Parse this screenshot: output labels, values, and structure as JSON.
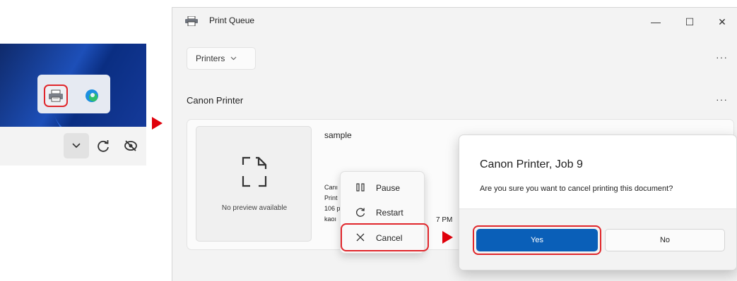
{
  "tray": {
    "icons": [
      "printer-icon",
      "edge-browser-icon",
      "chevron-down-icon",
      "sync-icon",
      "camera-off-icon"
    ]
  },
  "window": {
    "title": "Print Queue",
    "controls": {
      "minimize": "—",
      "maximize": "☐",
      "close": "✕"
    },
    "printers_button": "Printers",
    "more": "···",
    "section_title": "Canon Printer"
  },
  "job": {
    "name": "sample",
    "preview_text": "No preview available",
    "meta": [
      "Canı",
      "Print",
      "106 p",
      "kaoı"
    ],
    "time_fragment": "7 PM"
  },
  "context_menu": {
    "items": [
      {
        "label": "Pause",
        "icon": "pause-icon"
      },
      {
        "label": "Restart",
        "icon": "restart-icon"
      },
      {
        "label": "Cancel",
        "icon": "close-icon"
      }
    ]
  },
  "dialog": {
    "title": "Canon Printer, Job 9",
    "message": "Are you sure you want to cancel printing this document?",
    "yes_label": "Yes",
    "no_label": "No"
  },
  "colors": {
    "highlight": "#e0262b",
    "arrow": "#e0000b",
    "accent": "#0a5fb8"
  }
}
